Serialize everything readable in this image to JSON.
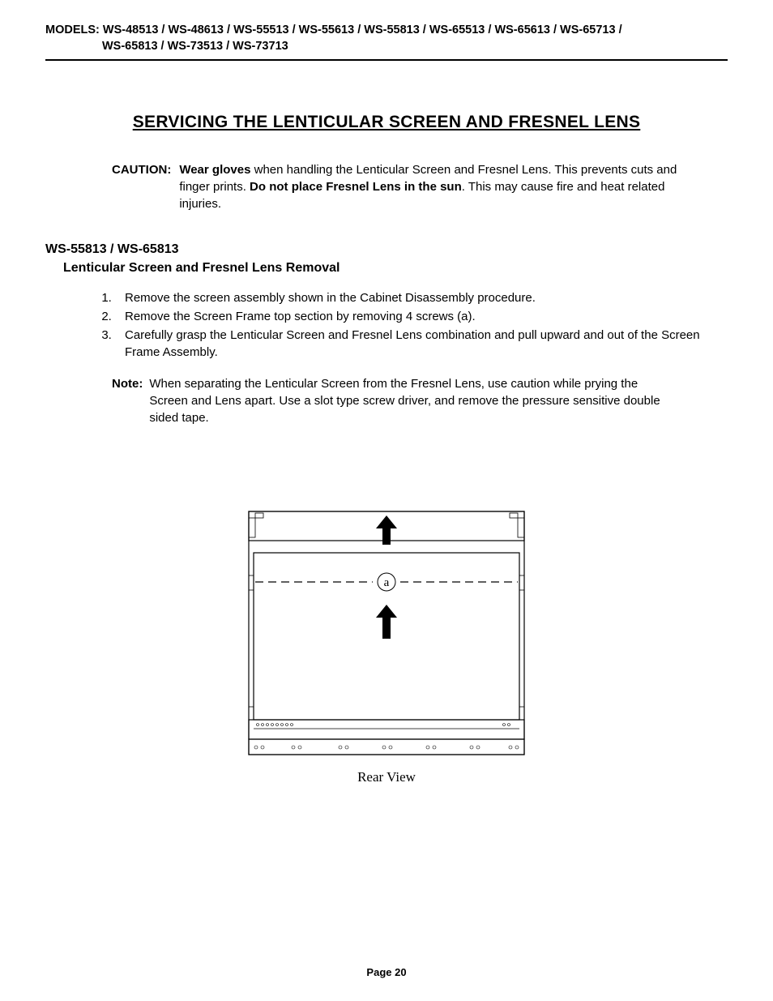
{
  "header": {
    "label": "MODELS:",
    "line1": "WS-48513 / WS-48613 / WS-55513 / WS-55613 / WS-55813 / WS-65513 / WS-65613 / WS-65713 /",
    "line2": "WS-65813 / WS-73513 / WS-73713"
  },
  "title": "SERVICING THE LENTICULAR SCREEN AND FRESNEL LENS",
  "caution": {
    "label": "CAUTION:",
    "bold1": "Wear gloves",
    "text1": " when handling the Lenticular Screen and Fresnel Lens. This prevents cuts and finger prints.  ",
    "bold2": "Do not place Fresnel Lens in the sun",
    "text2": ". This may cause fire and heat related injuries."
  },
  "subheading": {
    "line1": "WS-55813 / WS-65813",
    "line2": "Lenticular Screen and Fresnel Lens Removal"
  },
  "steps": [
    "Remove the screen assembly shown in the Cabinet Disassembly procedure.",
    "Remove the Screen Frame top section by removing 4 screws (a).",
    "Carefully grasp the Lenticular Screen and Fresnel Lens combination and pull upward and out of the Screen Frame Assembly."
  ],
  "note": {
    "label": "Note:",
    "text": "When separating the Lenticular Screen from the Fresnel Lens, use caution while prying the Screen and Lens apart.  Use a slot type screw driver, and remove the pressure sensitive double sided tape."
  },
  "diagram": {
    "callout": "a",
    "caption": "Rear View"
  },
  "page_number": "Page 20"
}
